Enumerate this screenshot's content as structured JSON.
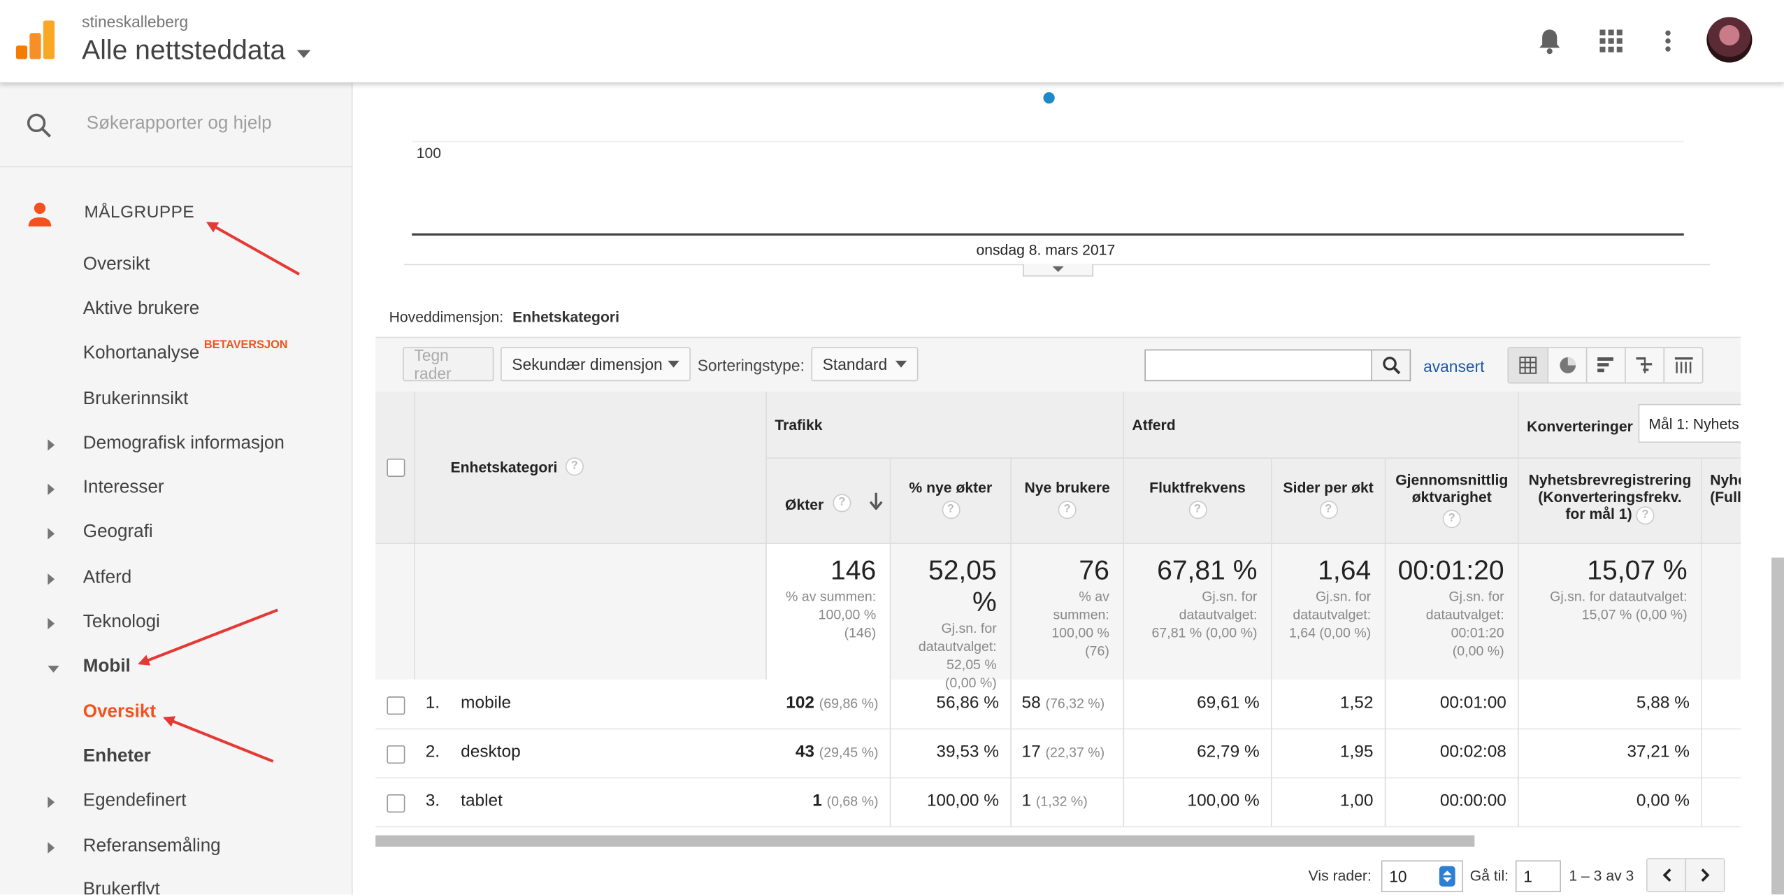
{
  "header": {
    "account": "stineskalleberg",
    "property": "Alle nettsteddata"
  },
  "sidebar": {
    "search_placeholder": "Søkerapporter og hjelp",
    "section_title": "MÅLGRUPPE",
    "items": [
      {
        "label": "Oversikt"
      },
      {
        "label": "Aktive brukere"
      },
      {
        "label": "Kohortanalyse",
        "badge": "BETAVERSJON"
      },
      {
        "label": "Brukerinnsikt"
      },
      {
        "label": "Demografisk informasjon"
      },
      {
        "label": "Interesser"
      },
      {
        "label": "Geografi"
      },
      {
        "label": "Atferd"
      },
      {
        "label": "Teknologi"
      },
      {
        "label": "Mobil"
      },
      {
        "label": "Oversikt"
      },
      {
        "label": "Enheter"
      },
      {
        "label": "Egendefinert"
      },
      {
        "label": "Referansemåling"
      },
      {
        "label": "Brukerflyt"
      }
    ]
  },
  "chart": {
    "y_tick": "100",
    "x_label": "onsdag 8. mars 2017",
    "point_color": "#1e88c8"
  },
  "dimension": {
    "label": "Hoveddimensjon:",
    "value": "Enhetskategori"
  },
  "controls": {
    "plot_rows": "Tegn rader",
    "secondary_dim": "Sekundær dimensjon",
    "sort_label": "Sorteringstype:",
    "sort_value": "Standard",
    "advanced": "avansert"
  },
  "table": {
    "groups": {
      "traffic": "Trafikk",
      "behavior": "Atferd",
      "conversions": "Konverteringer",
      "goal_select": "Mål 1: Nyhets"
    },
    "col_dim": "Enhetskategori",
    "cols": {
      "sessions": "Økter",
      "pct_new": "% nye økter",
      "new_users": "Nye brukere",
      "bounce": "Fluktfrekvens",
      "pages": "Sider per økt",
      "duration_1": "Gjennomsnittlig",
      "duration_2": "øktvarighet",
      "goal_1": "Nyhetsbrevregistrering",
      "goal_2": "(Konverteringsfrekv.",
      "goal_3": "for mål 1)",
      "cut_1": "Nyhe",
      "cut_2": "(Full"
    },
    "totals": {
      "sessions": "146",
      "sessions_s1": "% av summen:",
      "sessions_s2": "100,00 %",
      "sessions_s3": "(146)",
      "pct_new": "52,05 %",
      "pct_new_s1": "Gj.sn. for",
      "pct_new_s2": "datautvalget:",
      "pct_new_s3": "52,05 %",
      "pct_new_s4": "(0,00 %)",
      "new_users": "76",
      "new_users_s1": "% av",
      "new_users_s2": "summen:",
      "new_users_s3": "100,00 %",
      "new_users_s4": "(76)",
      "bounce": "67,81 %",
      "bounce_s1": "Gj.sn. for",
      "bounce_s2": "datautvalget:",
      "bounce_s3": "67,81 % (0,00 %)",
      "pages": "1,64",
      "pages_s1": "Gj.sn. for",
      "pages_s2": "datautvalget:",
      "pages_s3": "1,64 (0,00 %)",
      "duration": "00:01:20",
      "duration_s1": "Gj.sn. for",
      "duration_s2": "datautvalget:",
      "duration_s3": "00:01:20",
      "duration_s4": "(0,00 %)",
      "goal": "15,07 %",
      "goal_s1": "Gj.sn. for datautvalget:",
      "goal_s2": "15,07 % (0,00 %)"
    },
    "rows": [
      {
        "idx": "1.",
        "name": "mobile",
        "sessions": "102",
        "sessions_pct": "(69,86 %)",
        "pct_new": "56,86 %",
        "new_users": "58",
        "new_users_pct": "(76,32 %)",
        "bounce": "69,61 %",
        "pages": "1,52",
        "duration": "00:01:00",
        "goal": "5,88 %"
      },
      {
        "idx": "2.",
        "name": "desktop",
        "sessions": "43",
        "sessions_pct": "(29,45 %)",
        "pct_new": "39,53 %",
        "new_users": "17",
        "new_users_pct": "(22,37 %)",
        "bounce": "62,79 %",
        "pages": "1,95",
        "duration": "00:02:08",
        "goal": "37,21 %"
      },
      {
        "idx": "3.",
        "name": "tablet",
        "sessions": "1",
        "sessions_pct": "(0,68 %)",
        "pct_new": "100,00 %",
        "new_users": "1",
        "new_users_pct": "(1,32 %)",
        "bounce": "100,00 %",
        "pages": "1,00",
        "duration": "00:00:00",
        "goal": "0,00 %"
      }
    ]
  },
  "pager": {
    "show_rows": "Vis rader:",
    "rows_value": "10",
    "goto": "Gå til:",
    "goto_value": "1",
    "range": "1 – 3 av 3"
  },
  "colors": {
    "accent": "#f4511e",
    "annotation": "#e53935",
    "link": "#1a5aa8"
  }
}
